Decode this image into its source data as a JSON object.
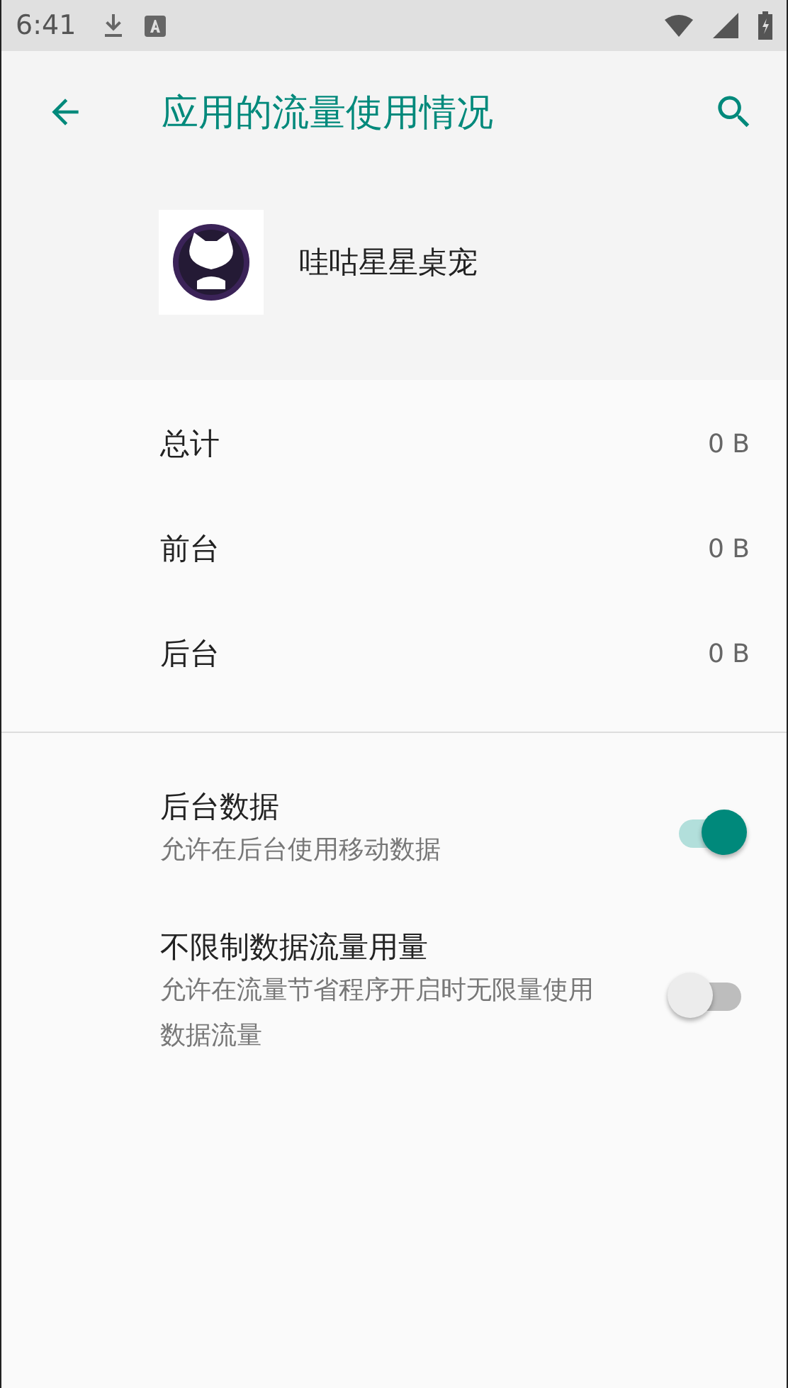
{
  "status_bar": {
    "time": "6:41"
  },
  "toolbar": {
    "title": "应用的流量使用情况"
  },
  "app": {
    "name": "哇咕星星桌宠"
  },
  "usage": [
    {
      "label": "总计",
      "value": "0 B"
    },
    {
      "label": "前台",
      "value": "0 B"
    },
    {
      "label": "后台",
      "value": "0 B"
    }
  ],
  "settings": [
    {
      "title": "后台数据",
      "summary": "允许在后台使用移动数据",
      "on": true
    },
    {
      "title": "不限制数据流量用量",
      "summary": "允许在流量节省程序开启时无限量使用数据流量",
      "on": false
    }
  ]
}
